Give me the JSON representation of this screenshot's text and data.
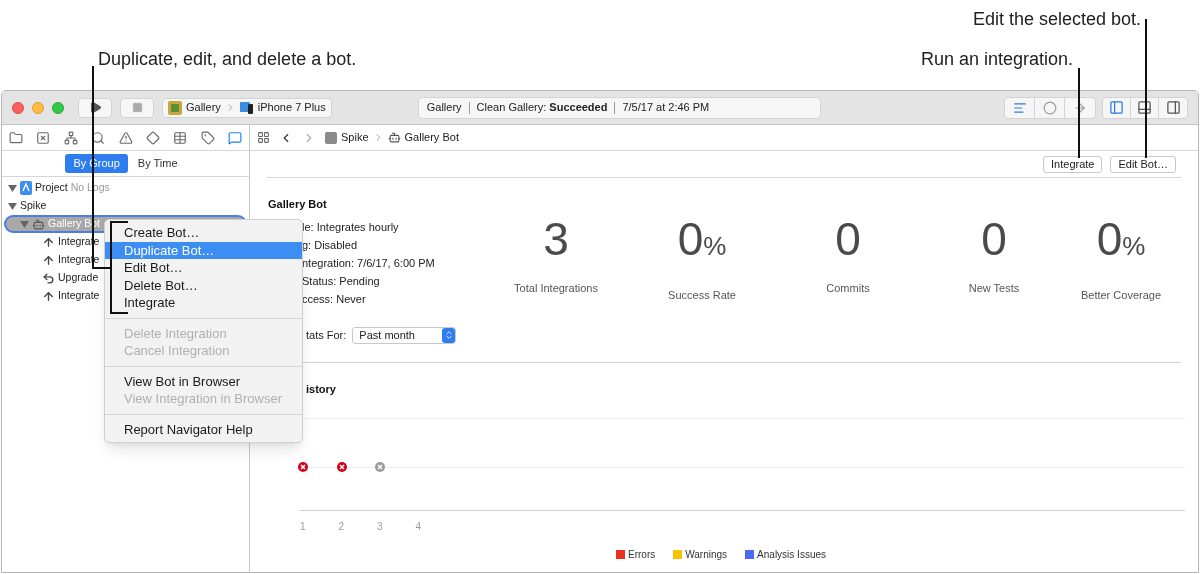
{
  "callouts": [
    {
      "text": "Duplicate, edit, and delete a bot."
    },
    {
      "text": "Run an integration."
    },
    {
      "text": "Edit the selected bot."
    }
  ],
  "toolbar": {
    "scheme": "Gallery",
    "device": "iPhone 7 Plus",
    "status": {
      "project": "Gallery",
      "activity": "Clean Gallery: **Succeeded**",
      "time": "7/5/17 at 2:46 PM"
    },
    "editor_modes": [
      {
        "kind": "standard",
        "selected": true
      },
      {
        "kind": "assistant",
        "selected": false
      },
      {
        "kind": "version",
        "selected": false
      }
    ],
    "panels": [
      {
        "kind": "navigator",
        "selected": true
      },
      {
        "kind": "debug",
        "selected": false
      },
      {
        "kind": "utilities",
        "selected": false
      }
    ]
  },
  "navigator_tabs": [
    {
      "kind": "folder",
      "selected": false
    },
    {
      "kind": "source",
      "selected": false
    },
    {
      "kind": "symbol",
      "selected": false
    },
    {
      "kind": "find",
      "selected": false
    },
    {
      "kind": "issue",
      "selected": false
    },
    {
      "kind": "test",
      "selected": false
    },
    {
      "kind": "debug",
      "selected": false
    },
    {
      "kind": "breakpoint",
      "selected": false
    },
    {
      "kind": "report",
      "selected": true
    }
  ],
  "filter": [
    {
      "label": "By Group",
      "selected": true
    },
    {
      "label": "By Time",
      "selected": false
    }
  ],
  "tree": [
    {
      "kind": "project",
      "label": "Project",
      "note": "No Logs",
      "expanded": true
    },
    {
      "kind": "group",
      "label": "Spike",
      "expanded": true,
      "children": [
        {
          "kind": "bot",
          "label": "Gallery Bot",
          "selected": true,
          "expanded": true,
          "children": [
            {
              "kind": "integrate",
              "label": "Integrate"
            },
            {
              "kind": "integrate",
              "label": "Integrate"
            },
            {
              "kind": "upgrade",
              "label": "Upgrade"
            },
            {
              "kind": "integrate",
              "label": "Integrate"
            }
          ]
        }
      ]
    }
  ],
  "path": [
    "Spike",
    "Gallery Bot"
  ],
  "buttons": [
    "Integrate",
    "Edit Bot…"
  ],
  "bot": {
    "title": "Gallery Bot",
    "details": [
      "le: Integrates hourly",
      "g: Disabled",
      "ntegration: 7/6/17, 6:00 PM",
      "Status: Pending",
      "ccess: Never"
    ],
    "stats_label": "tats For:",
    "stats_range": "Past month",
    "stats": [
      {
        "value": "3",
        "label": "Total Integrations"
      },
      {
        "value": "0",
        "unit": "%",
        "label": "Success Rate"
      },
      {
        "value": "0",
        "label": "Commits"
      },
      {
        "value": "0",
        "label": "New Tests"
      },
      {
        "value": "0",
        "unit": "%",
        "label": "Better Coverage"
      }
    ]
  },
  "history": {
    "title": "istory",
    "points": [
      {
        "kind": "error"
      },
      {
        "kind": "error"
      },
      {
        "kind": "cancelled"
      }
    ],
    "xticks": [
      "1",
      "2",
      "3",
      "4"
    ],
    "legend": [
      {
        "label": "Errors",
        "color": "#e8321e"
      },
      {
        "label": "Warnings",
        "color": "#f5c400"
      },
      {
        "label": "Analysis Issues",
        "color": "#4a6cf0"
      }
    ]
  },
  "menu": [
    {
      "kind": "item",
      "label": "Create Bot…",
      "selected": false,
      "disabled": false
    },
    {
      "kind": "item",
      "label": "Duplicate Bot…",
      "selected": true,
      "disabled": false
    },
    {
      "kind": "item",
      "label": "Edit Bot…",
      "selected": false,
      "disabled": false
    },
    {
      "kind": "item",
      "label": "Delete Bot…",
      "selected": false,
      "disabled": false
    },
    {
      "kind": "item",
      "label": "Integrate",
      "selected": false,
      "disabled": false
    },
    {
      "kind": "separator"
    },
    {
      "kind": "item",
      "label": "Delete Integration",
      "selected": false,
      "disabled": true
    },
    {
      "kind": "item",
      "label": "Cancel Integration",
      "selected": false,
      "disabled": true
    },
    {
      "kind": "separator"
    },
    {
      "kind": "item",
      "label": "View Bot in Browser",
      "selected": false,
      "disabled": false
    },
    {
      "kind": "item",
      "label": "View Integration in Browser",
      "selected": false,
      "disabled": true
    },
    {
      "kind": "separator"
    },
    {
      "kind": "item",
      "label": "Report Navigator Help",
      "selected": false,
      "disabled": false
    }
  ]
}
